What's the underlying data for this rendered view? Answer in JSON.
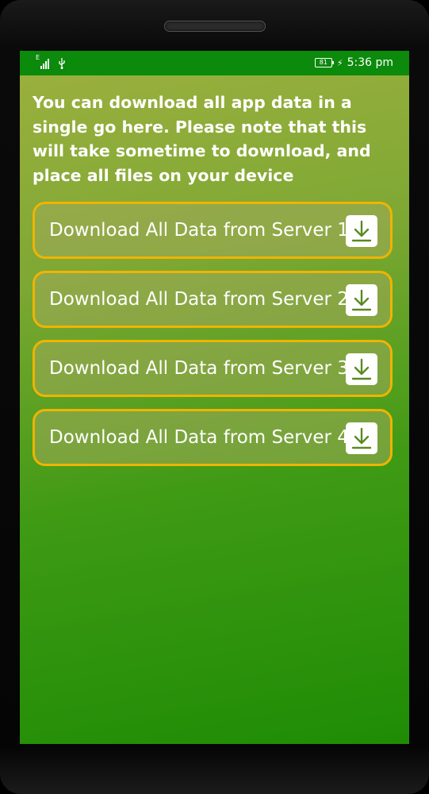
{
  "status_bar": {
    "network_type": "E",
    "battery_level": "81",
    "time": "5:36 pm",
    "icons": [
      "signal-icon",
      "usb-icon",
      "battery-icon",
      "charging-icon"
    ]
  },
  "intro_text": "You can download all app data in a single go here. Please note that this will take sometime to download, and place all files on your device",
  "buttons": [
    {
      "label": "Download All Data from Server 1",
      "icon": "download-icon"
    },
    {
      "label": "Download All Data from Server 2",
      "icon": "download-icon"
    },
    {
      "label": "Download All Data from Server 3",
      "icon": "download-icon"
    },
    {
      "label": "Download All Data from Server 4",
      "icon": "download-icon"
    }
  ],
  "colors": {
    "status_bar": "#0b8a0b",
    "button_border": "#f0b400",
    "text": "#ffffff"
  }
}
